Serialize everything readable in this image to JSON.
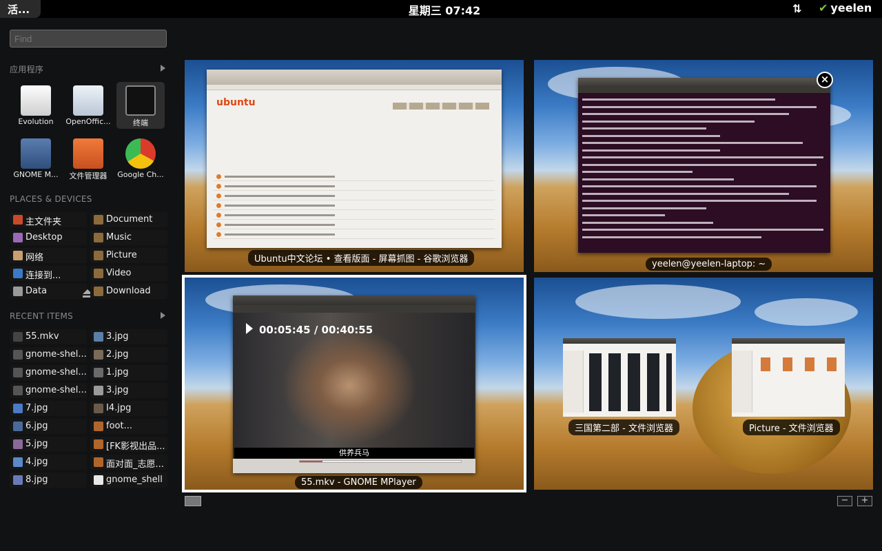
{
  "panel": {
    "activities": "活...",
    "clock": "星期三 07:42",
    "user": "yeelen"
  },
  "dash": {
    "find_placeholder": "Find",
    "applications_title": "应用程序",
    "apps": [
      {
        "label": "Evolution",
        "icon": "mail-envelope-icon"
      },
      {
        "label": "OpenOffic...",
        "icon": "document-writer-icon"
      },
      {
        "label": "终端",
        "icon": "terminal-icon"
      },
      {
        "label": "GNOME M...",
        "icon": "media-player-icon"
      },
      {
        "label": "文件管理器",
        "icon": "file-manager-folder-icon"
      },
      {
        "label": "Google Ch...",
        "icon": "chrome-browser-icon"
      }
    ],
    "places_title": "PLACES & DEVICES",
    "places": [
      {
        "label": "主文件夹",
        "icon": "home-folder-icon",
        "color": "#c84a2a"
      },
      {
        "label": "Document",
        "icon": "folder-document-icon",
        "color": "#8b6a3b"
      },
      {
        "label": "Desktop",
        "icon": "desktop-icon",
        "color": "#9a6ab8"
      },
      {
        "label": "Music",
        "icon": "folder-music-icon",
        "color": "#8b6a3b"
      },
      {
        "label": "网络",
        "icon": "network-icon",
        "color": "#c8a070"
      },
      {
        "label": "Picture",
        "icon": "folder-picture-icon",
        "color": "#8b6a3b"
      },
      {
        "label": "连接到...",
        "icon": "connect-server-icon",
        "color": "#3a7ac8"
      },
      {
        "label": "Video",
        "icon": "folder-video-icon",
        "color": "#8b6a3b"
      },
      {
        "label": "Data",
        "icon": "drive-icon",
        "color": "#9a9a9a"
      },
      {
        "label": "Download",
        "icon": "folder-download-icon",
        "color": "#8b6a3b"
      }
    ],
    "recent_title": "RECENT ITEMS",
    "recent": [
      {
        "label": "55.mkv",
        "icon": "video-file-icon",
        "color": "#444"
      },
      {
        "label": "3.jpg",
        "icon": "image-thumb-icon",
        "color": "#5a7fa8"
      },
      {
        "label": "gnome-shel...",
        "icon": "image-thumb-icon",
        "color": "#555"
      },
      {
        "label": "2.jpg",
        "icon": "image-thumb-icon",
        "color": "#7a6a5a"
      },
      {
        "label": "gnome-shel...",
        "icon": "image-thumb-icon",
        "color": "#555"
      },
      {
        "label": "1.jpg",
        "icon": "image-thumb-icon",
        "color": "#6a6a6a"
      },
      {
        "label": "gnome-shel...",
        "icon": "image-thumb-icon",
        "color": "#555"
      },
      {
        "label": "3.jpg",
        "icon": "image-thumb-icon",
        "color": "#9a9a9a"
      },
      {
        "label": "7.jpg",
        "icon": "image-thumb-icon",
        "color": "#4a7ac8"
      },
      {
        "label": "I4.jpg",
        "icon": "image-thumb-icon",
        "color": "#6a5a4a"
      },
      {
        "label": "6.jpg",
        "icon": "image-thumb-icon",
        "color": "#4a6a9a"
      },
      {
        "label": "foot...",
        "icon": "video-file-icon",
        "color": "#b0652a"
      },
      {
        "label": "5.jpg",
        "icon": "image-thumb-icon",
        "color": "#8a6a9a"
      },
      {
        "label": "[FK影视出品...",
        "icon": "video-file-icon",
        "color": "#b0652a"
      },
      {
        "label": "4.jpg",
        "icon": "image-thumb-icon",
        "color": "#5a8ac8"
      },
      {
        "label": "面对面_志愿...",
        "icon": "video-file-icon",
        "color": "#b0652a"
      },
      {
        "label": "8.jpg",
        "icon": "image-thumb-icon",
        "color": "#6a7ab8"
      },
      {
        "label": "gnome_shell",
        "icon": "text-file-icon",
        "color": "#e8e8e8"
      }
    ]
  },
  "windows": {
    "browser_caption": "Ubuntu中文论坛 • 查看版面 - 屏幕抓图 - 谷歌浏览器",
    "browser_logo": "ubuntu",
    "terminal_caption": "yeelen@yeelen-laptop: ~",
    "mplayer_caption": "55.mkv - GNOME MPlayer",
    "mplayer_osd": "00:05:45 / 00:40:55",
    "mplayer_subtitle": "供养兵马",
    "mplayer_progress": 0.14,
    "fb1_caption": "三国第二部 - 文件浏览器",
    "fb2_caption": "Picture - 文件浏览器"
  },
  "controls": {
    "zoom_out": "−",
    "zoom_in": "+",
    "close": "×"
  }
}
